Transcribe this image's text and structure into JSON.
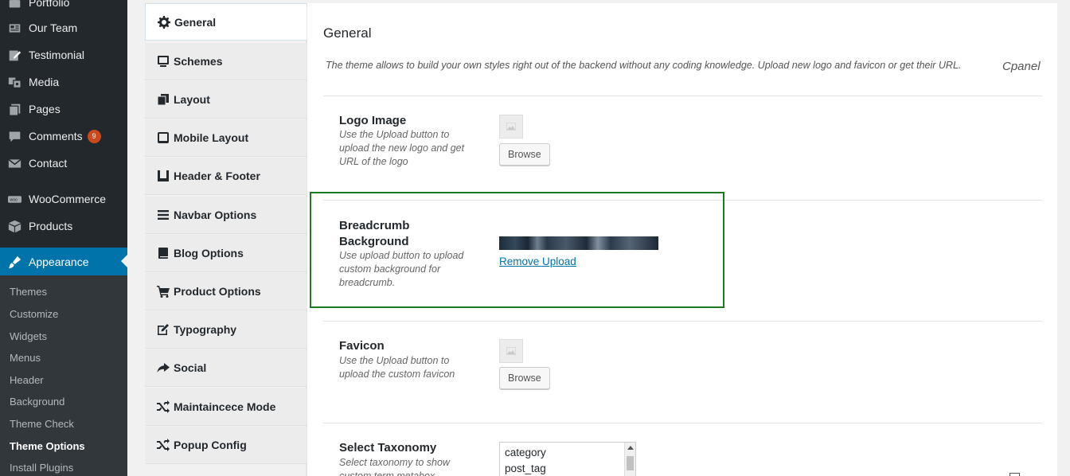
{
  "sidebar": {
    "items": [
      {
        "label": "Portfolio",
        "icon": "portfolio-icon"
      },
      {
        "label": "Our Team",
        "icon": "team-icon"
      },
      {
        "label": "Testimonial",
        "icon": "testimonial-icon"
      },
      {
        "label": "Media",
        "icon": "media-icon"
      },
      {
        "label": "Pages",
        "icon": "pages-icon"
      },
      {
        "label": "Comments",
        "icon": "comments-icon",
        "badge": "9"
      },
      {
        "label": "Contact",
        "icon": "contact-icon"
      },
      {
        "label": "WooCommerce",
        "icon": "woocommerce-icon"
      },
      {
        "label": "Products",
        "icon": "products-icon"
      },
      {
        "label": "Appearance",
        "icon": "appearance-icon"
      }
    ],
    "submenu": [
      "Themes",
      "Customize",
      "Widgets",
      "Menus",
      "Header",
      "Background",
      "Theme Check",
      "Theme Options",
      "Install Plugins"
    ],
    "active_submenu": "Theme Options"
  },
  "options_nav": {
    "tabs": [
      {
        "label": "General",
        "icon": "gear-icon"
      },
      {
        "label": "Schemes",
        "icon": "monitor-icon"
      },
      {
        "label": "Layout",
        "icon": "copy-icon"
      },
      {
        "label": "Mobile Layout",
        "icon": "tablet-icon"
      },
      {
        "label": "Header & Footer",
        "icon": "header-footer-icon"
      },
      {
        "label": "Navbar Options",
        "icon": "bars-icon"
      },
      {
        "label": "Blog Options",
        "icon": "book-icon"
      },
      {
        "label": "Product Options",
        "icon": "cart-icon"
      },
      {
        "label": "Typography",
        "icon": "edit-icon"
      },
      {
        "label": "Social",
        "icon": "share-icon"
      },
      {
        "label": "Maintaincece Mode",
        "icon": "shuffle-icon"
      },
      {
        "label": "Popup Config",
        "icon": "shuffle-icon"
      }
    ],
    "active_tab": "General"
  },
  "main": {
    "title": "General",
    "description": "The theme allows to build your own styles right out of the backend without any coding knowledge. Upload new logo and favicon or get their URL.",
    "cpanel_label": "Cpanel",
    "fields": {
      "logo": {
        "label": "Logo Image",
        "help": "Use the Upload button to upload the new logo and get URL of the logo",
        "button": "Browse"
      },
      "breadcrumb": {
        "label": "Breadcrumb Background",
        "help": "Use upload button to upload custom background for breadcrumb.",
        "remove_link": "Remove Upload"
      },
      "favicon": {
        "label": "Favicon",
        "help": "Use the Upload button to upload the custom favicon",
        "button": "Browse"
      },
      "taxonomy": {
        "label": "Select Taxonomy",
        "help": "Select taxonomy to show custom term metabox",
        "options": [
          "category",
          "post_tag"
        ]
      }
    }
  },
  "colors": {
    "sidebar_bg": "#23282d",
    "sidebar_active": "#0073aa",
    "submenu_bg": "#32373c",
    "highlight_border": "#1e7a1e",
    "link": "#0073aa",
    "badge": "#ca4a1f"
  }
}
